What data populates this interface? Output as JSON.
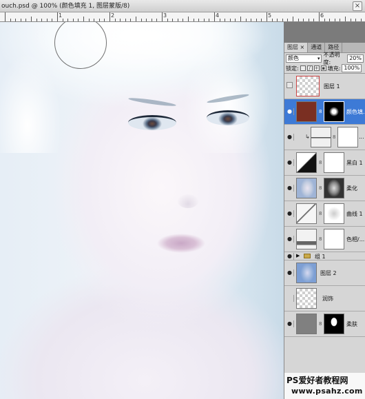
{
  "document": {
    "title": "ouch.psd @ 100% (颜色填充 1, 图层蒙版/8)",
    "close_glyph": "×"
  },
  "ruler": {
    "labels": [
      "1",
      "2",
      "3",
      "4",
      "5",
      "6",
      "7",
      "8"
    ]
  },
  "layers_panel": {
    "tabs": [
      {
        "label": "图层 ×",
        "active": true
      },
      {
        "label": "通道",
        "active": false
      },
      {
        "label": "路径",
        "active": false
      }
    ],
    "blend_mode": "颜色",
    "opacity_label": "不透明度:",
    "opacity_value": "20%",
    "lock_label": "锁定:",
    "fill_label": "填充:",
    "fill_value": "100%",
    "layers": [
      {
        "name": "图层 1",
        "visible": false,
        "thumb": "checker-red-marquee"
      },
      {
        "name": "颜色填...",
        "visible": true,
        "selected": true,
        "thumb": "brown-fill",
        "mask": "black-white-spot"
      },
      {
        "name": "...",
        "visible": true,
        "clipped": true,
        "thumb": "levels-icon"
      },
      {
        "name": "黑白 1",
        "visible": true,
        "thumb": "bw-icon"
      },
      {
        "name": "柔化",
        "visible": true,
        "thumb": "face-photo",
        "mask": "face-mask"
      },
      {
        "name": "曲线 1",
        "visible": true,
        "thumb": "curves-icon"
      },
      {
        "name": "色相/...",
        "visible": true,
        "thumb": "hue-icon"
      },
      {
        "name": "组 1",
        "visible": true,
        "group": true
      },
      {
        "name": "图层 2",
        "visible": true,
        "thumb": "face-photo"
      },
      {
        "name": "润饰",
        "visible": false,
        "thumb": "checker"
      },
      {
        "name": "柔肤",
        "visible": true,
        "thumb": "gray-fill",
        "mask": "portrait-mask"
      }
    ]
  },
  "watermark": {
    "line1": "PS爱好者教程网",
    "line2": "www.psahz.com"
  },
  "colors": {
    "selection": "#3d7ad6",
    "fill_swatch": "#7a2f22",
    "panel": "#d6d6d6"
  }
}
